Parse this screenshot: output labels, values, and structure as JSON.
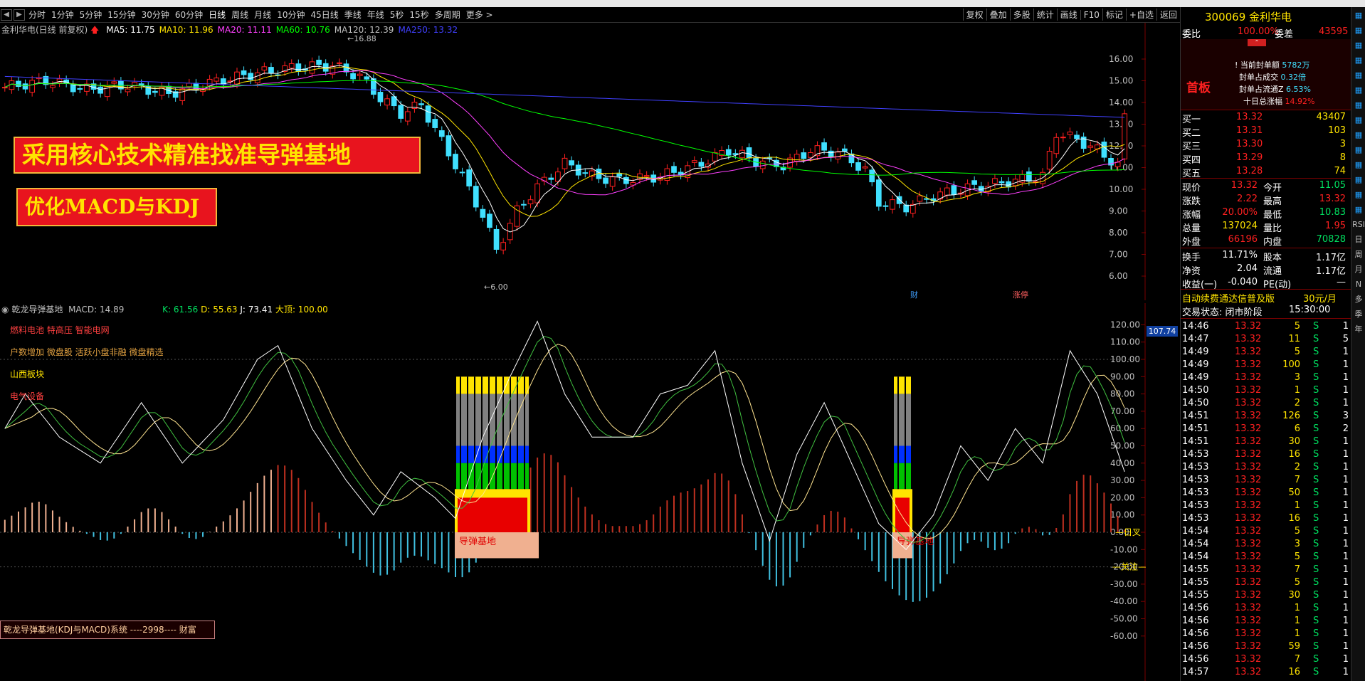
{
  "periods": [
    "分时",
    "1分钟",
    "5分钟",
    "15分钟",
    "30分钟",
    "60分钟",
    "日线",
    "周线",
    "月线",
    "10分钟",
    "45日线",
    "季线",
    "年线",
    "5秒",
    "15秒",
    "多周期",
    "更多 >"
  ],
  "active_period": "日线",
  "tools": [
    "复权",
    "叠加",
    "多股",
    "统计",
    "画线",
    "F10",
    "标记",
    "+自选",
    "返回"
  ],
  "main": {
    "stock_label": "金利华电(日线 前复权)",
    "ma_labels": [
      {
        "text": "MA5: 11.75",
        "color": "#ffffff"
      },
      {
        "text": "MA10: 11.96",
        "color": "#ffe400"
      },
      {
        "text": "MA20: 11.11",
        "color": "#ff40ff"
      },
      {
        "text": "MA60: 10.76",
        "color": "#00ff00"
      },
      {
        "text": "MA120: 12.39",
        "color": "#c0c0c0"
      },
      {
        "text": "MA250: 13.32",
        "color": "#4040ff"
      }
    ],
    "high_label": "16.88",
    "low_label": "6.00",
    "yaxis": [
      "16.00",
      "15.00",
      "14.00",
      "13.00",
      "12.00",
      "11.00",
      "10.00",
      "9.00",
      "8.00",
      "7.00",
      "6.00"
    ],
    "marker_cai": "财",
    "marker_zhangting": "涨停"
  },
  "banners": {
    "line1": "采用核心技术精准找准导弹基地",
    "line2": "优化MACD与KDJ"
  },
  "sub": {
    "title": "乾龙导弹基地",
    "macd_label": "MACD: 14.89",
    "k_label": "K: 61.56",
    "d_label": "D: 55.63",
    "j_label": "J: 73.41",
    "big_label": "大顶: 100.00",
    "sectors": [
      {
        "text": "燃料电池 特高压 智能电网",
        "color": "#ff4040"
      },
      {
        "text": "户数增加 微盘股 活跃小盘非融 微盘精选",
        "color": "#e0a040"
      },
      {
        "text": "山西板块",
        "color": "#ffe400"
      },
      {
        "text": "电气设备",
        "color": "#ff4040"
      }
    ],
    "base_label1": "导弹基地",
    "base_label2": "导弹基地",
    "yaxis": [
      "120.00",
      "110.00",
      "100.00",
      "90.00",
      "80.00",
      "70.00",
      "60.00",
      "50.00",
      "40.00",
      "30.00",
      "20.00",
      "10.00",
      "0.00",
      "-10.00",
      "-20.00",
      "-30.00",
      "-40.00",
      "-50.00",
      "-60.00"
    ],
    "current_tag": "107.74",
    "ri_cha": "日叉",
    "guanzhu": "关注",
    "footer": "乾龙导弹基地(KDJ与MACD)系统   ----2998---- 财富"
  },
  "quote": {
    "code_name": "300069 金利华电",
    "weibi_label": "委比",
    "weibi": "100.00%",
    "weicha_label": "委差",
    "weicha": "43595",
    "first_board": "首板",
    "seal_amount_label": "当前封单额",
    "seal_amount": "5782万",
    "seal_vol_label": "封单占成交",
    "seal_vol": "0.32倍",
    "seal_float_label": "封单占流通Z",
    "seal_float": "6.53%",
    "ten_day_label": "十日总涨幅",
    "ten_day": "14.92%",
    "bids": [
      {
        "label": "买一",
        "price": "13.32",
        "vol": "43407"
      },
      {
        "label": "买二",
        "price": "13.31",
        "vol": "103"
      },
      {
        "label": "买三",
        "price": "13.30",
        "vol": "3"
      },
      {
        "label": "买四",
        "price": "13.29",
        "vol": "8"
      },
      {
        "label": "买五",
        "price": "13.28",
        "vol": "74"
      }
    ],
    "stats": [
      {
        "l1": "现价",
        "v1": "13.32",
        "c1": "red",
        "l2": "今开",
        "v2": "11.05",
        "c2": "green"
      },
      {
        "l1": "涨跌",
        "v1": "2.22",
        "c1": "red",
        "l2": "最高",
        "v2": "13.32",
        "c2": "red"
      },
      {
        "l1": "涨幅",
        "v1": "20.00%",
        "c1": "red",
        "l2": "最低",
        "v2": "10.83",
        "c2": "green"
      },
      {
        "l1": "总量",
        "v1": "137024",
        "c1": "yellow",
        "l2": "量比",
        "v2": "1.95",
        "c2": "red"
      },
      {
        "l1": "外盘",
        "v1": "66196",
        "c1": "red",
        "l2": "内盘",
        "v2": "70828",
        "c2": "green"
      }
    ],
    "stats2": [
      {
        "l1": "换手",
        "v1": "11.71%",
        "l2": "股本",
        "v2": "1.17亿"
      },
      {
        "l1": "净资",
        "v1": "2.04",
        "l2": "流通",
        "v2": "1.17亿"
      },
      {
        "l1": "收益(一)",
        "v1": "-0.040",
        "l2": "PE(动)",
        "v2": "—"
      }
    ],
    "ad": "自动续费通达信普及版",
    "ad_price": "30元/月",
    "trade_state": "交易状态: 闭市阶段",
    "trade_time": "15:30:00"
  },
  "ticks": [
    {
      "t": "14:46",
      "p": "13.32",
      "v": "5",
      "s": "S",
      "n": "1"
    },
    {
      "t": "14:47",
      "p": "13.32",
      "v": "11",
      "s": "S",
      "n": "5"
    },
    {
      "t": "14:49",
      "p": "13.32",
      "v": "5",
      "s": "S",
      "n": "1"
    },
    {
      "t": "14:49",
      "p": "13.32",
      "v": "100",
      "s": "S",
      "n": "1"
    },
    {
      "t": "14:49",
      "p": "13.32",
      "v": "3",
      "s": "S",
      "n": "1"
    },
    {
      "t": "14:50",
      "p": "13.32",
      "v": "1",
      "s": "S",
      "n": "1"
    },
    {
      "t": "14:50",
      "p": "13.32",
      "v": "2",
      "s": "S",
      "n": "1"
    },
    {
      "t": "14:51",
      "p": "13.32",
      "v": "126",
      "s": "S",
      "n": "3"
    },
    {
      "t": "14:51",
      "p": "13.32",
      "v": "6",
      "s": "S",
      "n": "2"
    },
    {
      "t": "14:51",
      "p": "13.32",
      "v": "30",
      "s": "S",
      "n": "1"
    },
    {
      "t": "14:53",
      "p": "13.32",
      "v": "16",
      "s": "S",
      "n": "1"
    },
    {
      "t": "14:53",
      "p": "13.32",
      "v": "2",
      "s": "S",
      "n": "1"
    },
    {
      "t": "14:53",
      "p": "13.32",
      "v": "7",
      "s": "S",
      "n": "1"
    },
    {
      "t": "14:53",
      "p": "13.32",
      "v": "50",
      "s": "S",
      "n": "1"
    },
    {
      "t": "14:53",
      "p": "13.32",
      "v": "1",
      "s": "S",
      "n": "1"
    },
    {
      "t": "14:53",
      "p": "13.32",
      "v": "16",
      "s": "S",
      "n": "1"
    },
    {
      "t": "14:54",
      "p": "13.32",
      "v": "5",
      "s": "S",
      "n": "1"
    },
    {
      "t": "14:54",
      "p": "13.32",
      "v": "3",
      "s": "S",
      "n": "1"
    },
    {
      "t": "14:54",
      "p": "13.32",
      "v": "5",
      "s": "S",
      "n": "1"
    },
    {
      "t": "14:55",
      "p": "13.32",
      "v": "7",
      "s": "S",
      "n": "1"
    },
    {
      "t": "14:55",
      "p": "13.32",
      "v": "5",
      "s": "S",
      "n": "1"
    },
    {
      "t": "14:55",
      "p": "13.32",
      "v": "30",
      "s": "S",
      "n": "1"
    },
    {
      "t": "14:56",
      "p": "13.32",
      "v": "1",
      "s": "S",
      "n": "1"
    },
    {
      "t": "14:56",
      "p": "13.32",
      "v": "1",
      "s": "S",
      "n": "1"
    },
    {
      "t": "14:56",
      "p": "13.32",
      "v": "1",
      "s": "S",
      "n": "1"
    },
    {
      "t": "14:56",
      "p": "13.32",
      "v": "59",
      "s": "S",
      "n": "1"
    },
    {
      "t": "14:56",
      "p": "13.32",
      "v": "7",
      "s": "S",
      "n": "1"
    },
    {
      "t": "14:57",
      "p": "13.32",
      "v": "16",
      "s": "S",
      "n": "1"
    }
  ],
  "side_strip": [
    "RSI",
    "日",
    "周",
    "月",
    "N",
    "多",
    "季",
    "年"
  ],
  "colors": {
    "up": "#ff2020",
    "down": "#40e0ff",
    "ma5": "#ffffff",
    "ma10": "#ffe400",
    "ma20": "#ff40ff",
    "ma60": "#00ff00",
    "ma250": "#4040ff",
    "axis": "#7a0000"
  }
}
